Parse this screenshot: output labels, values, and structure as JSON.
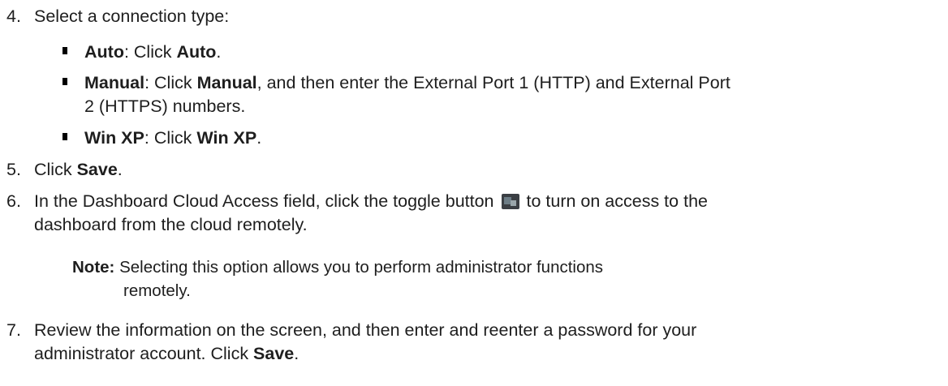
{
  "steps": {
    "s4": {
      "num": "4.",
      "text": "Select a connection type:",
      "sub": [
        {
          "bold": "Auto",
          "mid": ": Click ",
          "bold2": "Auto",
          "end": "."
        },
        {
          "bold": "Manual",
          "mid": ": Click ",
          "bold2": "Manual",
          "end": ", and then enter the External Port 1 (HTTP) and External Port",
          "line2": "2 (HTTPS) numbers."
        },
        {
          "bold": "Win XP",
          "mid": ": Click ",
          "bold2": "Win XP",
          "end": "."
        }
      ]
    },
    "s5": {
      "num": "5.",
      "pre": "Click ",
      "bold": "Save",
      "end": "."
    },
    "s6": {
      "num": "6.",
      "pre": "In the Dashboard Cloud Access field, click the toggle button",
      "post": "to turn on access to the",
      "line2": "dashboard from the cloud remotely.",
      "icon": "toggle-button-icon"
    },
    "note": {
      "label": "Note:",
      "line1": "Selecting this option allows you to perform administrator functions",
      "line2": "remotely."
    },
    "s7": {
      "num": "7.",
      "line1": "Review the information on the screen, and then enter and reenter a password for your",
      "line2": "administrator account. Click ",
      "bold": "Save",
      "end": "."
    }
  }
}
